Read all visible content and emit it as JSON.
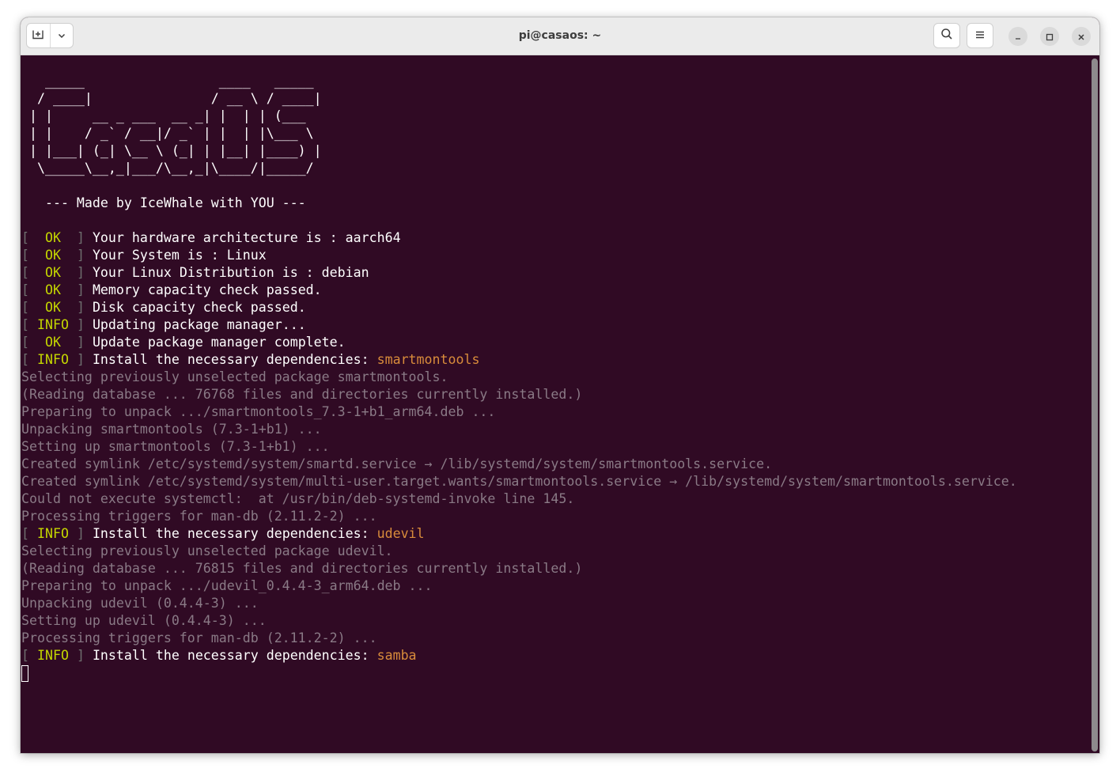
{
  "window": {
    "title": "pi@casaos: ~",
    "icons": {
      "new_tab": "new-tab-icon",
      "dropdown": "chevron-down-icon",
      "search": "search-icon",
      "menu": "hamburger-menu-icon",
      "minimize": "minimize-icon",
      "maximize": "maximize-icon",
      "close": "close-icon"
    }
  },
  "terminal": {
    "colors": {
      "background": "#300a24",
      "ok": "#c4d600",
      "package": "#d98c3b",
      "dim": "#8a7a86"
    },
    "ascii_art": [
      "   _____                 ____   _____ ",
      "  / ____|               / __ \\ / ____|",
      " | |     __ _ ___  __ _| |  | | (___  ",
      " | |    / _` / __|/ _` | |  | |\\___ \\ ",
      " | |___| (_| \\__ \\ (_| | |__| |____) |",
      "  \\_____\\__,_|___/\\__,_|\\____/|_____/ "
    ],
    "tagline": "   --- Made by IceWhale with YOU ---",
    "status_lines": [
      {
        "tag": "  OK  ",
        "text": " Your hardware architecture is : aarch64"
      },
      {
        "tag": "  OK  ",
        "text": " Your System is : Linux"
      },
      {
        "tag": "  OK  ",
        "text": " Your Linux Distribution is : debian"
      },
      {
        "tag": "  OK  ",
        "text": " Memory capacity check passed."
      },
      {
        "tag": "  OK  ",
        "text": " Disk capacity check passed."
      },
      {
        "tag": " INFO ",
        "text": " Updating package manager..."
      },
      {
        "tag": "  OK  ",
        "text": " Update package manager complete."
      }
    ],
    "install_blocks": [
      {
        "tag": " INFO ",
        "text": " Install the necessary dependencies: ",
        "package": "smartmontools",
        "output": [
          "Selecting previously unselected package smartmontools.",
          "(Reading database ... 76768 files and directories currently installed.)",
          "Preparing to unpack .../smartmontools_7.3-1+b1_arm64.deb ...",
          "Unpacking smartmontools (7.3-1+b1) ...",
          "Setting up smartmontools (7.3-1+b1) ...",
          "Created symlink /etc/systemd/system/smartd.service → /lib/systemd/system/smartmontools.service.",
          "Created symlink /etc/systemd/system/multi-user.target.wants/smartmontools.service → /lib/systemd/system/smartmontools.service.",
          "Could not execute systemctl:  at /usr/bin/deb-systemd-invoke line 145.",
          "Processing triggers for man-db (2.11.2-2) ..."
        ]
      },
      {
        "tag": " INFO ",
        "text": " Install the necessary dependencies: ",
        "package": "udevil",
        "output": [
          "Selecting previously unselected package udevil.",
          "(Reading database ... 76815 files and directories currently installed.)",
          "Preparing to unpack .../udevil_0.4.4-3_arm64.deb ...",
          "Unpacking udevil (0.4.4-3) ...",
          "Setting up udevil (0.4.4-3) ...",
          "Processing triggers for man-db (2.11.2-2) ..."
        ]
      },
      {
        "tag": " INFO ",
        "text": " Install the necessary dependencies: ",
        "package": "samba",
        "output": []
      }
    ]
  }
}
